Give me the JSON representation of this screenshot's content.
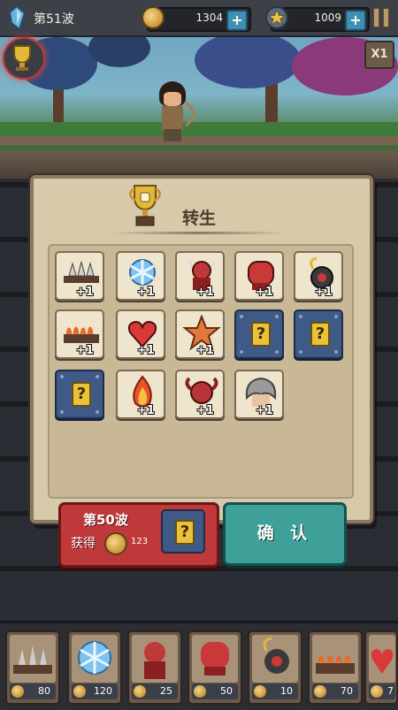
{
  "topbar": {
    "wave_label": "第51波",
    "coins": "1304",
    "stars": "1009"
  },
  "game": {
    "speed_label": "X1"
  },
  "dialog": {
    "title": "转生",
    "items": [
      {
        "name": "spike-trap",
        "bonus": "+1"
      },
      {
        "name": "ice-crystal",
        "bonus": "+1"
      },
      {
        "name": "horned-warrior",
        "bonus": "+1"
      },
      {
        "name": "boxing-glove",
        "bonus": "+1"
      },
      {
        "name": "bomb",
        "bonus": "+1"
      },
      {
        "name": "fire-trap",
        "bonus": "+1"
      },
      {
        "name": "heart-potion",
        "bonus": "+1"
      },
      {
        "name": "starfish",
        "bonus": "+1"
      },
      {
        "name": "unknown",
        "mark": "?"
      },
      {
        "name": "unknown",
        "mark": "?"
      },
      {
        "name": "unknown",
        "mark": "?"
      },
      {
        "name": "flame",
        "bonus": "+1"
      },
      {
        "name": "ram-skull",
        "bonus": "+1"
      },
      {
        "name": "grey-hair",
        "bonus": "+1"
      }
    ],
    "reward": {
      "wave_label": "第50波",
      "get_label": "获得",
      "amount": "123",
      "mark": "?"
    },
    "confirm_label": "确 认"
  },
  "shop": [
    {
      "item": "spike-trap",
      "price": "80"
    },
    {
      "item": "ice-crystal",
      "price": "120"
    },
    {
      "item": "horned-warrior",
      "price": "25"
    },
    {
      "item": "boxing-glove",
      "price": "50"
    },
    {
      "item": "bomb",
      "price": "10"
    },
    {
      "item": "fire-trap",
      "price": "70"
    },
    {
      "item": "heart-potion",
      "price": "7"
    }
  ]
}
